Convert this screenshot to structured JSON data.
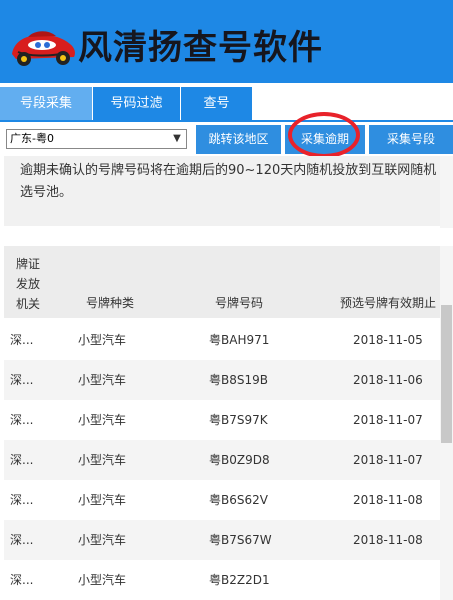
{
  "app": {
    "title": "风清扬查号软件"
  },
  "tabs": [
    {
      "label": "号段采集"
    },
    {
      "label": "号码过滤"
    },
    {
      "label": "查号"
    }
  ],
  "toolbar": {
    "region_value": "广东-粤0",
    "jump_label": "跳转该地区",
    "collect_overdue_label": "采集逾期",
    "collect_segment_label": "采集号段"
  },
  "info": {
    "text": "逾期未确认的号牌号码将在逾期后的90~120天内随机投放到互联网随机选号池。"
  },
  "table": {
    "headers": {
      "org": "牌证发放机关",
      "type": "号牌种类",
      "plate": "号牌号码",
      "expire": "预选号牌有效期止"
    },
    "rows": [
      {
        "org": "深...",
        "type": "小型汽车",
        "plate": "粤BAH971",
        "date": "2018-11-05"
      },
      {
        "org": "深...",
        "type": "小型汽车",
        "plate": "粤B8S19B",
        "date": "2018-11-06"
      },
      {
        "org": "深...",
        "type": "小型汽车",
        "plate": "粤B7S97K",
        "date": "2018-11-07"
      },
      {
        "org": "深...",
        "type": "小型汽车",
        "plate": "粤B0Z9D8",
        "date": "2018-11-07"
      },
      {
        "org": "深...",
        "type": "小型汽车",
        "plate": "粤B6S62V",
        "date": "2018-11-08"
      },
      {
        "org": "深...",
        "type": "小型汽车",
        "plate": "粤B7S67W",
        "date": "2018-11-08"
      },
      {
        "org": "深...",
        "type": "小型汽车",
        "plate": "粤B2Z2D1",
        "date": ""
      }
    ]
  },
  "colors": {
    "accent": "#1e88e5",
    "active_tab": "#62aef0",
    "highlight_ring": "#e8222a"
  }
}
